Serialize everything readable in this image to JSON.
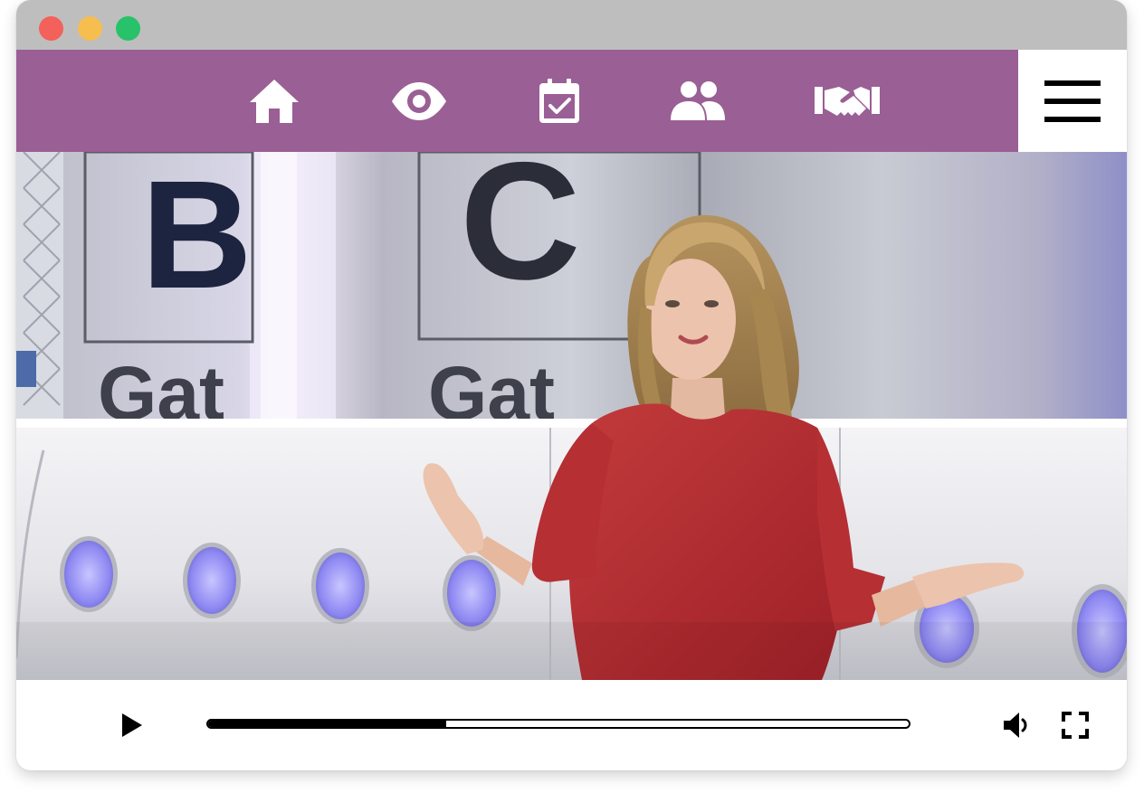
{
  "window": {
    "traffic_lights": {
      "close": "#f4605a",
      "minimize": "#f6bd4f",
      "maximize": "#27c269"
    }
  },
  "navbar": {
    "background": "#9a5f95",
    "icon_color": "#ffffff",
    "items": [
      {
        "icon": "home-icon"
      },
      {
        "icon": "eye-icon"
      },
      {
        "icon": "calendar-check-icon"
      },
      {
        "icon": "users-icon"
      },
      {
        "icon": "handshake-icon"
      }
    ],
    "menu_icon": "hamburger-menu-icon"
  },
  "video": {
    "backdrop_text": [
      "B",
      "C",
      "Gat",
      "Gat"
    ]
  },
  "player": {
    "play_icon": "play-icon",
    "progress_fraction": 0.34,
    "volume_icon": "volume-icon",
    "fullscreen_icon": "fullscreen-icon"
  }
}
